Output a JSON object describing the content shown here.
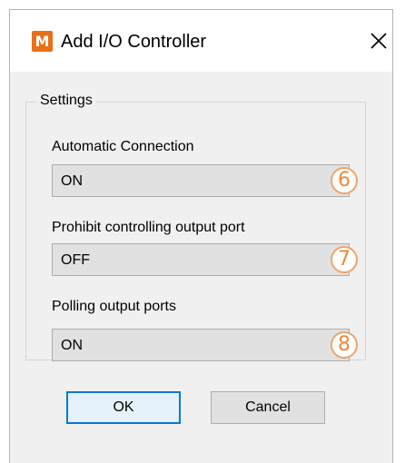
{
  "window": {
    "app_icon_letter": "M",
    "title": "Add I/O Controller",
    "close_glyph": "X"
  },
  "settings": {
    "group_label": "Settings",
    "fields": [
      {
        "label": "Automatic Connection",
        "value": "ON",
        "callout": "6"
      },
      {
        "label": "Prohibit controlling output port",
        "value": "OFF",
        "callout": "7"
      },
      {
        "label": "Polling output ports",
        "value": "ON",
        "callout": "8"
      }
    ]
  },
  "buttons": {
    "ok": "OK",
    "cancel": "Cancel"
  },
  "colors": {
    "accent": "#0078d7",
    "app_icon": "#e8701a",
    "callout": "#ec8a3c"
  }
}
